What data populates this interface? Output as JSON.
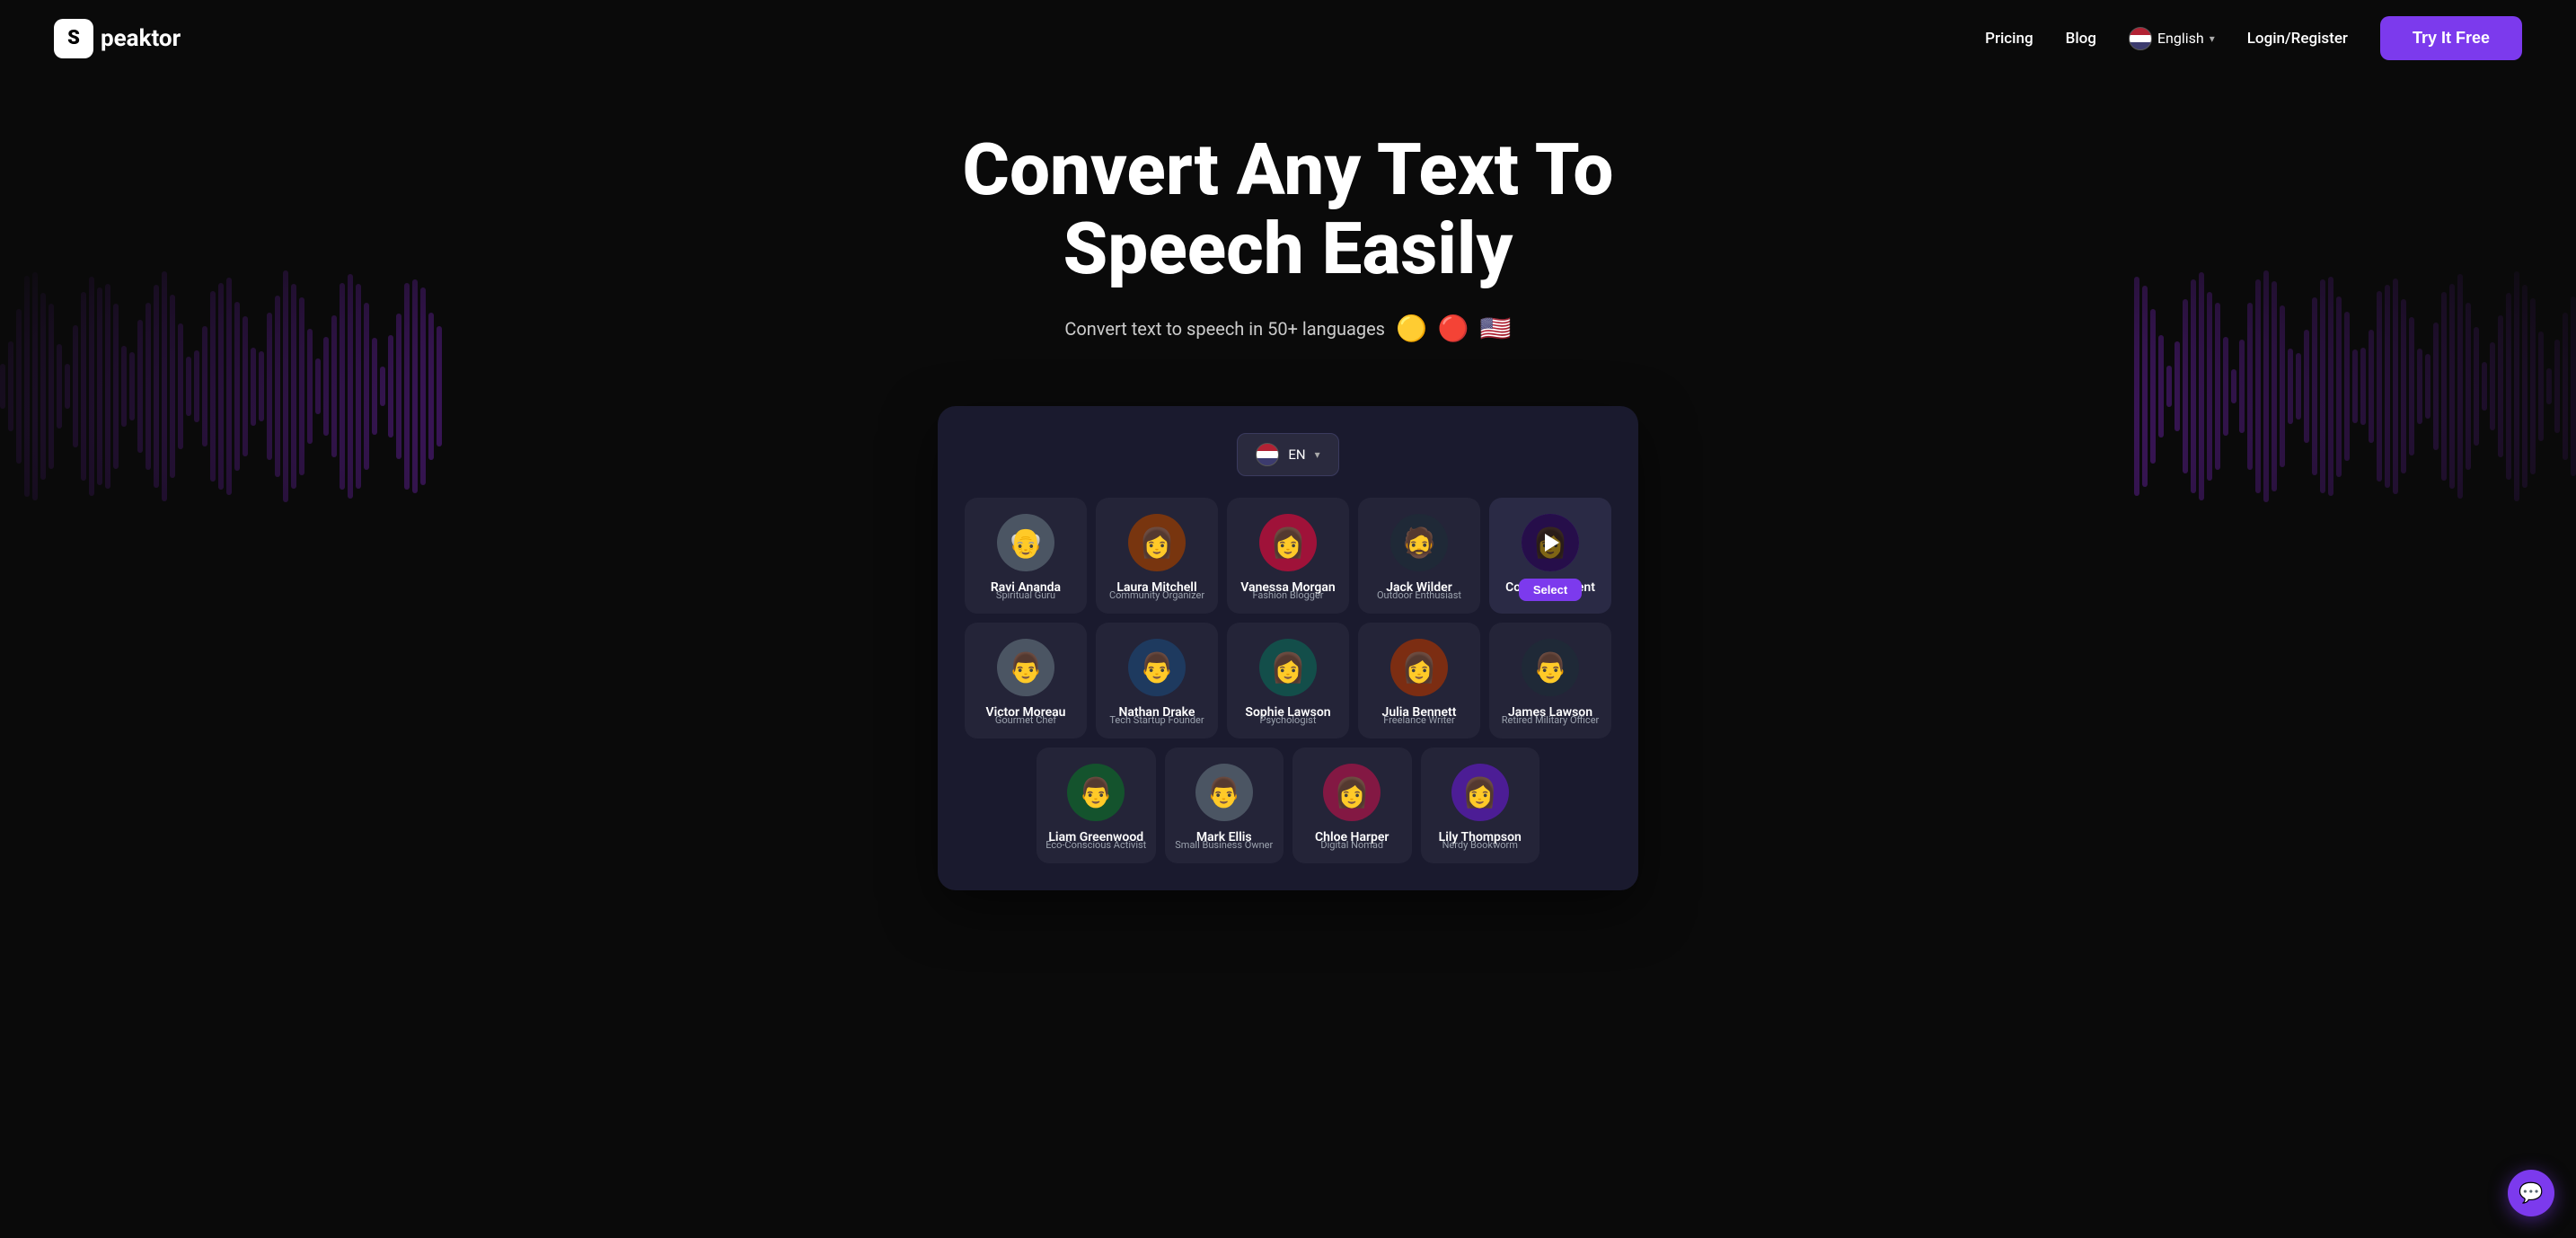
{
  "brand": {
    "logo_letter": "S",
    "name": "peaktor"
  },
  "nav": {
    "pricing": "Pricing",
    "blog": "Blog",
    "language": "English",
    "login": "Login/Register",
    "try_btn": "Try It Free"
  },
  "hero": {
    "title": "Convert Any Text To Speech Easily",
    "subtitle": "Convert text to speech in 50+ languages"
  },
  "app": {
    "lang_code": "EN",
    "voices_row1": [
      {
        "name": "Ravi Ananda",
        "role": "Spiritual Guru",
        "emoji": "👴",
        "bg": "gray"
      },
      {
        "name": "Laura Mitchell",
        "role": "Community Organizer",
        "emoji": "👩",
        "bg": "brown"
      },
      {
        "name": "Vanessa Morgan",
        "role": "Fashion Blogger",
        "emoji": "👩‍🦱",
        "bg": "rose"
      },
      {
        "name": "Jack Wilder",
        "role": "Outdoor Enthusiast",
        "emoji": "🧔",
        "bg": "dark"
      },
      {
        "name": "College Student",
        "role": "",
        "emoji": "👩‍🎓",
        "bg": "purple",
        "selected": true
      }
    ],
    "voices_row2": [
      {
        "name": "Victor Moreau",
        "role": "Gourmet Chef",
        "emoji": "👨‍🍳",
        "bg": "gray"
      },
      {
        "name": "Nathan Drake",
        "role": "Tech Startup Founder",
        "emoji": "👨",
        "bg": "blue"
      },
      {
        "name": "Sophie Lawson",
        "role": "Psychologist",
        "emoji": "👩",
        "bg": "teal"
      },
      {
        "name": "Julia Bennett",
        "role": "Freelance Writer",
        "emoji": "👩‍🦰",
        "bg": "orange"
      },
      {
        "name": "James Lawson",
        "role": "Retired Military Officer",
        "emoji": "👨‍🦳",
        "bg": "dark"
      }
    ],
    "voices_row3": [
      {
        "name": "Liam Greenwood",
        "role": "Eco-Conscious Activist",
        "emoji": "👨",
        "bg": "green"
      },
      {
        "name": "Mark Ellis",
        "role": "Small Business Owner",
        "emoji": "👨‍🦱",
        "bg": "gray"
      },
      {
        "name": "Chloe Harper",
        "role": "Digital Nomad",
        "emoji": "👩‍🦱",
        "bg": "pink"
      },
      {
        "name": "Lily Thompson",
        "role": "Nerdy Bookworm",
        "emoji": "👩‍🏫",
        "bg": "purple"
      }
    ],
    "select_label": "Select"
  },
  "chat": {
    "icon": "💬"
  }
}
